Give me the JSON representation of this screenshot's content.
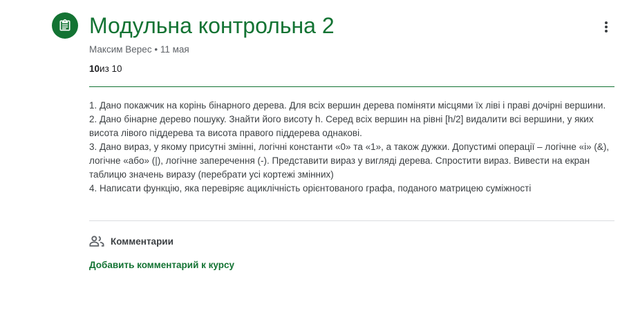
{
  "assignment": {
    "icon": "assignment-icon",
    "title": "Модульна контрольна 2",
    "author": "Максим Верес",
    "separator": "•",
    "date": "11 мая",
    "score": "10",
    "score_suffix": "из 10",
    "more_icon": "more-vert-icon"
  },
  "description": {
    "lines": [
      "1. Дано покажчик на корінь бінарного дерева. Для всіх вершин дерева поміняти місцями їх ліві і праві дочірні вершини.",
      "2. Дано бінарне дерево пошуку. Знайти його висоту h. Серед всіх вершин на рівні [h/2] видалити всі вершини, у яких висота лівого піддерева та висота правого піддерева однакові.",
      "3. Дано вираз, у якому присутні змінні, логічні константи «0» та «1», а також дужки. Допустимі операції – логічне «і» (&), логічне «або» (|), логічне заперечення (-). Представити вираз у вигляді дерева. Спростити вираз. Вивести на екран таблицю значень виразу (перебрати усі кортежі змінних)",
      "4. Написати функцію, яка перевіряє ациклічність орієнтованого графа, поданого матрицею суміжності"
    ]
  },
  "comments": {
    "icon": "people-icon",
    "label": "Комментарии",
    "add_link": "Добавить комментарий к курсу"
  },
  "colors": {
    "accent": "#137333",
    "text": "#3c4043",
    "muted": "#5f6368"
  }
}
